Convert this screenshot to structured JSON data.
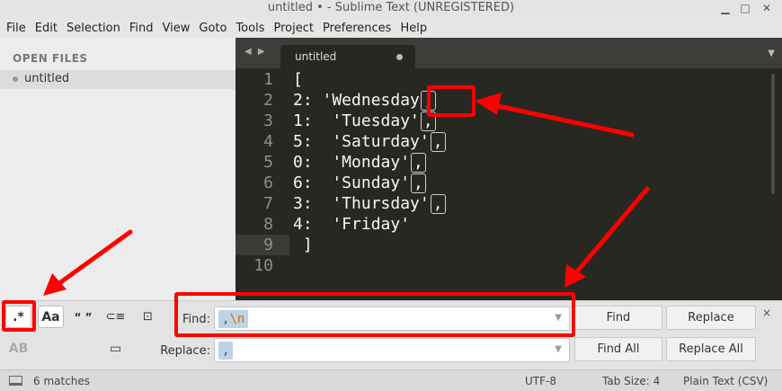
{
  "window": {
    "title": "untitled • - Sublime Text (UNREGISTERED)"
  },
  "menu": [
    "File",
    "Edit",
    "Selection",
    "Find",
    "View",
    "Goto",
    "Tools",
    "Project",
    "Preferences",
    "Help"
  ],
  "sidebar": {
    "header": "OPEN FILES",
    "files": [
      "untitled"
    ]
  },
  "tabs": [
    {
      "label": "untitled",
      "dirty": true
    }
  ],
  "editor": {
    "lines": [
      {
        "num": "1",
        "text": "[",
        "comma": false
      },
      {
        "num": "2",
        "text": "2: 'Wednesday",
        "comma": true
      },
      {
        "num": "3",
        "text": "1:  'Tuesday'",
        "comma": true
      },
      {
        "num": "4",
        "text": "5:  'Saturday'",
        "comma": true
      },
      {
        "num": "5",
        "text": "0:  'Monday'",
        "comma": true
      },
      {
        "num": "6",
        "text": "6:  'Sunday'",
        "comma": true
      },
      {
        "num": "7",
        "text": "3:  'Thursday'",
        "comma": true
      },
      {
        "num": "8",
        "text": "4:  'Friday'",
        "comma": false
      },
      {
        "num": "9",
        "text": " ]",
        "comma": false
      },
      {
        "num": "10",
        "text": "",
        "comma": false
      }
    ],
    "active_line": "9"
  },
  "find_panel": {
    "options": {
      "regex": ".*",
      "case": "Aa",
      "whole_word": "“ ”",
      "wrap": "⊂≡",
      "in_selection": "⊡",
      "preserve_case": "AB",
      "highlight": "▭"
    },
    "find_label": "Find:",
    "find_value_plain": ",",
    "find_value_escape": "\\n",
    "replace_label": "Replace:",
    "replace_value": ",",
    "buttons": {
      "find": "Find",
      "replace": "Replace",
      "find_all": "Find All",
      "replace_all": "Replace All"
    },
    "close": "×"
  },
  "status": {
    "matches": "6 matches",
    "encoding": "UTF-8",
    "tab_size": "Tab Size: 4",
    "syntax": "Plain Text (CSV)"
  },
  "colors": {
    "annotation": "#ff0000",
    "editor_bg": "#272822",
    "find_highlight": "#bcd3e8"
  }
}
